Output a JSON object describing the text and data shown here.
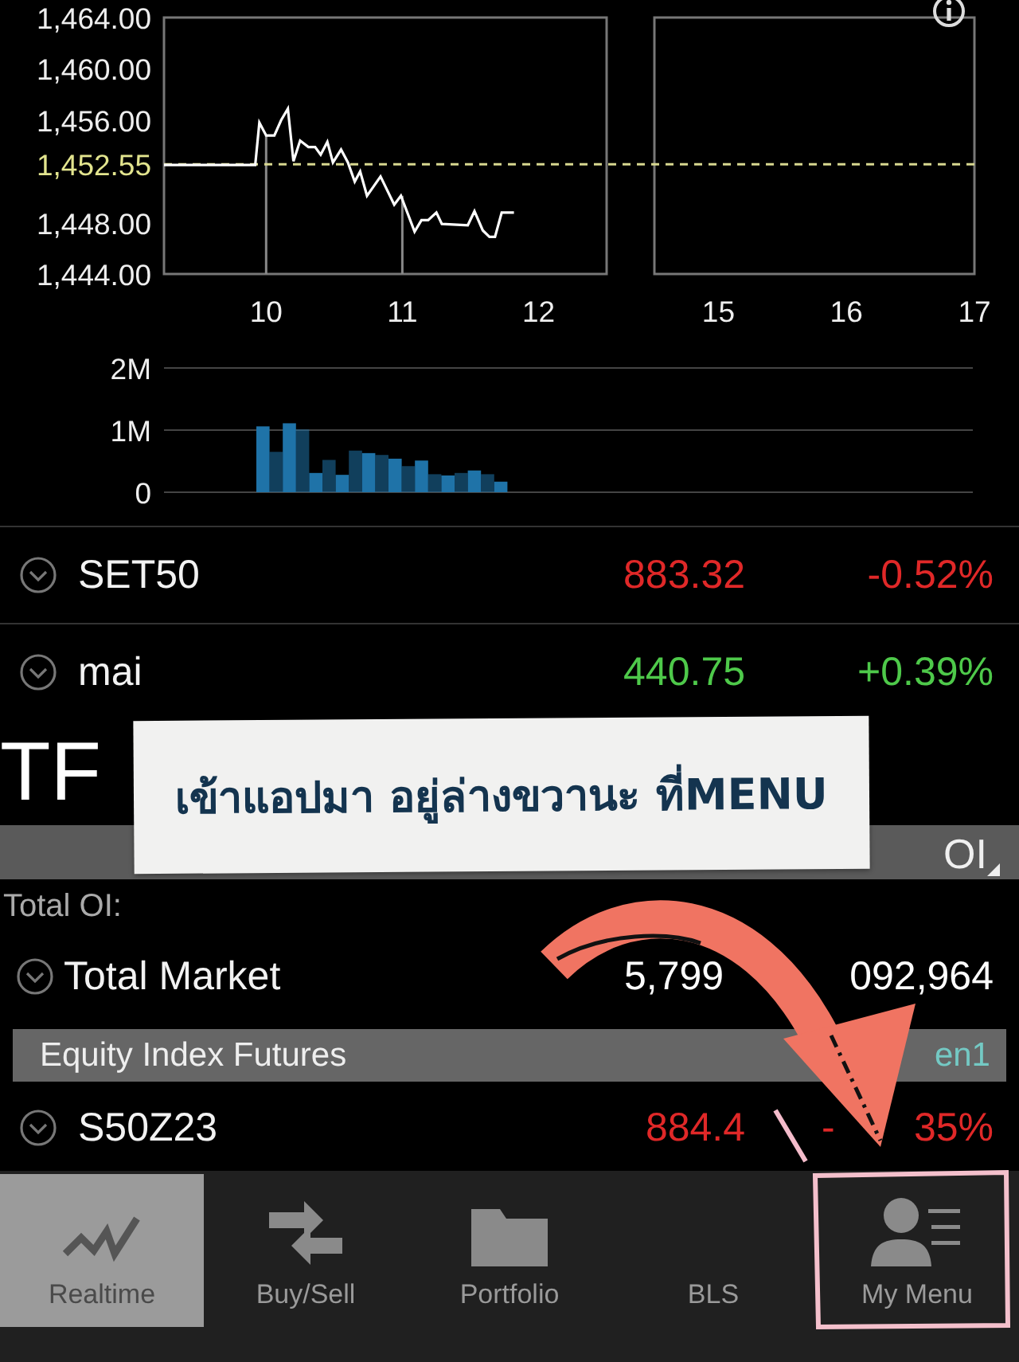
{
  "price_chart": {
    "chart_data": {
      "type": "line",
      "x": [
        9.25,
        9.92,
        9.95,
        10,
        10.06,
        10.11,
        10.16,
        10.2,
        10.25,
        10.31,
        10.36,
        10.4,
        10.45,
        10.49,
        10.55,
        10.6,
        10.65,
        10.69,
        10.74,
        10.84,
        10.94,
        10.99,
        11.09,
        11.14,
        11.19,
        11.25,
        11.29,
        11.48,
        11.53,
        11.59,
        11.64,
        11.68,
        11.73,
        11.82
      ],
      "series": [
        {
          "color": "#ffffff",
          "values": [
            1452.5,
            1452.5,
            1455.8,
            1454.8,
            1454.8,
            1456,
            1456.9,
            1452.8,
            1454.4,
            1453.9,
            1453.9,
            1453.3,
            1454.3,
            1452.7,
            1453.7,
            1452.7,
            1451.2,
            1452,
            1450.1,
            1451.6,
            1449.4,
            1450.1,
            1447.3,
            1448.2,
            1448.2,
            1448.8,
            1447.9,
            1447.8,
            1448.9,
            1447.4,
            1446.9,
            1446.9,
            1448.8,
            1448.8
          ]
        }
      ],
      "xlim": [
        9.25,
        12.5
      ],
      "ylim": [
        1444,
        1464
      ],
      "yticks": [
        {
          "value": 1444,
          "label": "1,444.00"
        },
        {
          "value": 1448,
          "label": "1,448.00"
        },
        {
          "value": 1452.55,
          "label": "1,452.55"
        },
        {
          "value": 1456,
          "label": "1,456.00"
        },
        {
          "value": 1460,
          "label": "1,460.00"
        },
        {
          "value": 1464,
          "label": "1,464.00"
        }
      ],
      "xticks": [
        10,
        11,
        12
      ],
      "ref_lines": [
        {
          "axis": "y",
          "value": 1452.55
        },
        {
          "axis": "x",
          "value": 10
        },
        {
          "axis": "x",
          "value": 11
        }
      ]
    }
  },
  "afternoon_chart": {
    "chart_data": {
      "type": "line",
      "xlim": [
        14.5,
        17
      ],
      "ylim": [
        1444,
        1464
      ],
      "xticks": [
        15,
        16,
        17
      ],
      "ref_lines": [
        {
          "axis": "y",
          "value": 1452.55
        }
      ]
    }
  },
  "volume_chart": {
    "chart_data": {
      "type": "bar",
      "series": [
        {
          "color": "#1f73a8",
          "values": [
            1.06,
            0.65,
            1.11,
            1.01,
            0.31,
            0.52,
            0.28,
            0.67,
            0.63,
            0.6,
            0.54,
            0.42,
            0.51,
            0.29,
            0.27,
            0.31,
            0.35,
            0.29,
            0.17
          ]
        }
      ],
      "ylim": [
        0,
        2
      ],
      "yticks": [
        {
          "value": 0,
          "label": "0"
        },
        {
          "value": 1,
          "label": "1M"
        },
        {
          "value": 2,
          "label": "2M"
        }
      ]
    }
  },
  "indices": [
    {
      "name": "SET50",
      "value": "883.32",
      "change": "-0.52%",
      "color": "#e02828"
    },
    {
      "name": "mai",
      "value": "440.75",
      "change": "+0.39%",
      "color": "#4ec94a"
    }
  ],
  "section_title": "TF",
  "oi_header": "OI",
  "total_oi_label": "Total OI:",
  "total_market": {
    "name": "Total Market",
    "value_parts": [
      "5,799",
      "092,964"
    ]
  },
  "group_header": {
    "title": "Equity Index Futures",
    "tag": "en1"
  },
  "futures": [
    {
      "name": "S50Z23",
      "value": "884.4",
      "change_parts": [
        "-",
        "35%"
      ],
      "color": "#e02828"
    }
  ],
  "tabs": [
    {
      "label": "Realtime",
      "selected": true
    },
    {
      "label": "Buy/Sell",
      "selected": false
    },
    {
      "label": "Portfolio",
      "selected": false
    },
    {
      "label": "BLS",
      "selected": false
    },
    {
      "label": "My Menu",
      "selected": false
    }
  ],
  "note": {
    "text": "เข้าแอปมา อยู่ล่างขวานะ ที่MENU"
  }
}
